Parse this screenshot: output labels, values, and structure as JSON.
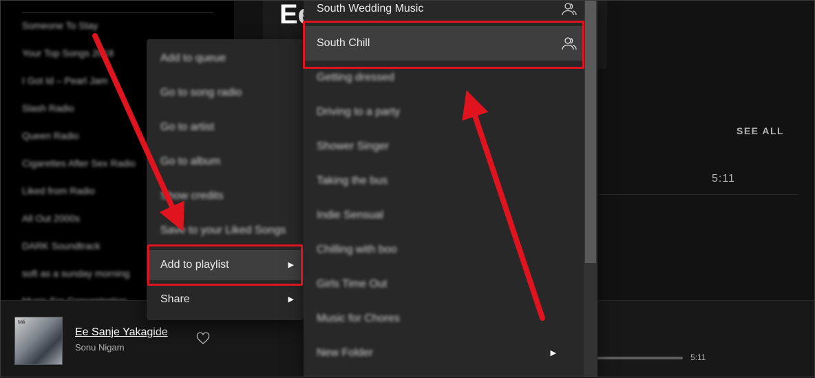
{
  "sidebar": {
    "items": [
      {
        "label": "Someone To Stay"
      },
      {
        "label": "Your Top Songs 2018"
      },
      {
        "label": "I Got Id – Pearl Jam"
      },
      {
        "label": "Slash Radio"
      },
      {
        "label": "Queen Radio"
      },
      {
        "label": "Cigarettes After Sex Radio"
      },
      {
        "label": "Liked from Radio"
      },
      {
        "label": "All Out 2000s"
      },
      {
        "label": "DARK Soundtrack"
      },
      {
        "label": "soft as a sunday morning"
      },
      {
        "label": "Music For Concentration"
      }
    ]
  },
  "main": {
    "title": "Ee",
    "see_all": "SEE ALL",
    "duration": "5:11"
  },
  "context_menu": {
    "items": [
      {
        "label": "Add to queue"
      },
      {
        "label": "Go to song radio"
      },
      {
        "label": "Go to artist"
      },
      {
        "label": "Go to album"
      },
      {
        "label": "Show credits"
      },
      {
        "label": "Save to your Liked Songs"
      },
      {
        "label": "Add to playlist"
      },
      {
        "label": "Share"
      }
    ],
    "chevron": "▶"
  },
  "playlist_submenu": {
    "items": [
      {
        "label": "South Wedding Music",
        "icon": "collaborative-icon"
      },
      {
        "label": "South Chill",
        "icon": "collaborative-icon"
      },
      {
        "label": "Getting dressed"
      },
      {
        "label": "Driving to a party"
      },
      {
        "label": "Shower Singer"
      },
      {
        "label": "Taking the bus"
      },
      {
        "label": "Indie Sensual"
      },
      {
        "label": "Chilling with boo"
      },
      {
        "label": "Girls Time Out"
      },
      {
        "label": "Music for Chores"
      },
      {
        "label": "New Folder"
      }
    ],
    "chevron": "▶"
  },
  "player": {
    "track_title": "Ee Sanje Yakagide",
    "artist": "Sonu Nigam",
    "time_end": "5:11",
    "cover_text": "Mili"
  },
  "colors": {
    "accent_red": "#e0141e",
    "menu_bg": "#282828",
    "menu_active": "#3e3e3e",
    "app_bg": "#121212"
  }
}
